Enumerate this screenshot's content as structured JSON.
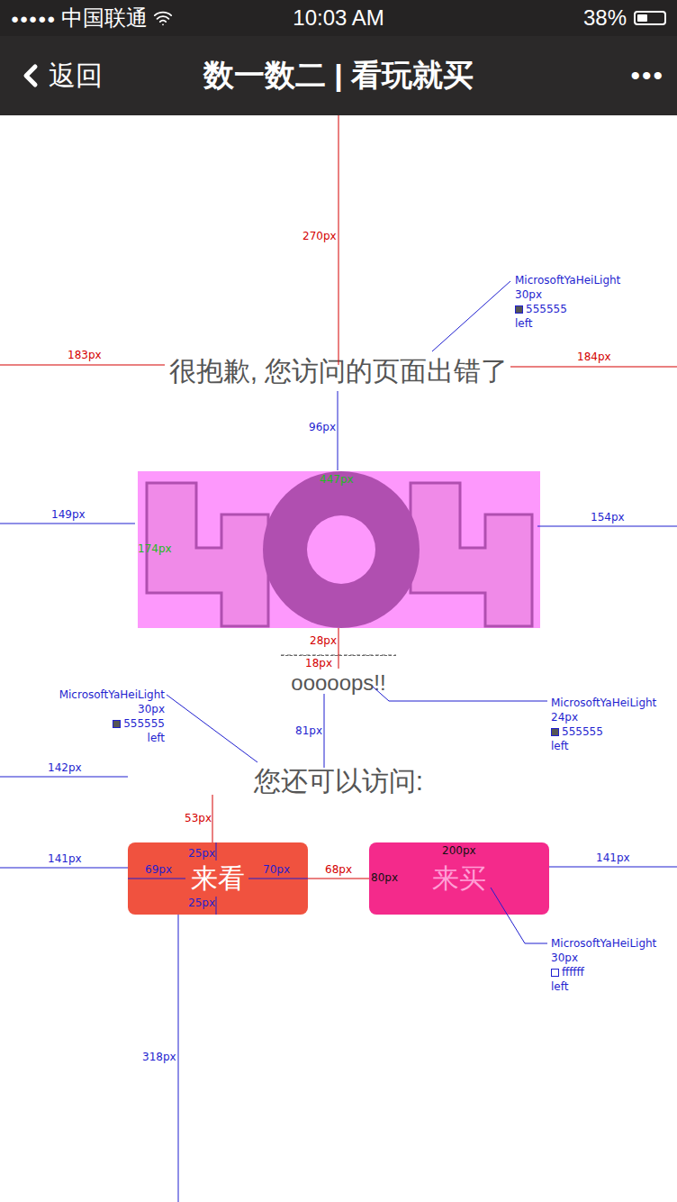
{
  "status_bar": {
    "signal": "●●●●●",
    "carrier": "中国联通",
    "time": "10:03 AM",
    "battery": "38%",
    "level": 0.38
  },
  "nav": {
    "back": "返回",
    "title": "数一数二 | 看玩就买",
    "more": "•••"
  },
  "error": {
    "title": "很抱歉, 您访问的页面出错了",
    "oops": "ooooops!!",
    "hint": "您还可以访问:"
  },
  "buttons": [
    {
      "label": "来看",
      "color": "#f0523f",
      "text_color": "#ffffff"
    },
    {
      "label": "来买",
      "color": "#f42a8b",
      "text_color": "#ff9fd6"
    }
  ],
  "annotations": [
    {
      "text": "270px",
      "color": "#d40000"
    },
    {
      "text": "183px",
      "color": "#d40000"
    },
    {
      "text": "184px",
      "color": "#d40000"
    },
    {
      "text": "96px",
      "color": "#1f1fcf"
    },
    {
      "text": "447px",
      "color": "#22bb22"
    },
    {
      "text": "174px",
      "color": "#22bb22"
    },
    {
      "text": "149px",
      "color": "#1f1fcf"
    },
    {
      "text": "154px",
      "color": "#1f1fcf"
    },
    {
      "text": "28px",
      "color": "#d40000"
    },
    {
      "text": "18px",
      "color": "#d40000"
    },
    {
      "text": "81px",
      "color": "#1f1fcf"
    },
    {
      "text": "142px",
      "color": "#1f1fcf"
    },
    {
      "text": "53px",
      "color": "#d40000"
    },
    {
      "text": "25px",
      "color": "#1f1fcf"
    },
    {
      "text": "141px",
      "color": "#1f1fcf"
    },
    {
      "text": "69px",
      "color": "#1f1fcf"
    },
    {
      "text": "70px",
      "color": "#1f1fcf"
    },
    {
      "text": "68px",
      "color": "#d40000"
    },
    {
      "text": "80px",
      "color": "#111111"
    },
    {
      "text": "200px",
      "color": "#111111"
    },
    {
      "text": "141px",
      "color": "#1f1fcf"
    },
    {
      "text": "25px",
      "color": "#1f1fcf"
    },
    {
      "text": "318px",
      "color": "#1f1fcf"
    }
  ],
  "font_notes": [
    {
      "font": "MicrosoftYaHeiLight",
      "size": "30px",
      "code": "555555",
      "swatch": "#555555",
      "align": "left"
    },
    {
      "font": "MicrosoftYaHeiLight",
      "size": "24px",
      "code": "555555",
      "swatch": "#555555",
      "align": "left"
    },
    {
      "font": "MicrosoftYaHeiLight",
      "size": "30px",
      "code": "555555",
      "swatch": "#555555",
      "align": "left"
    },
    {
      "font": "MicrosoftYaHeiLight",
      "size": "30px",
      "code": "ffffff",
      "swatch": "#ffffff",
      "align": "left"
    }
  ]
}
